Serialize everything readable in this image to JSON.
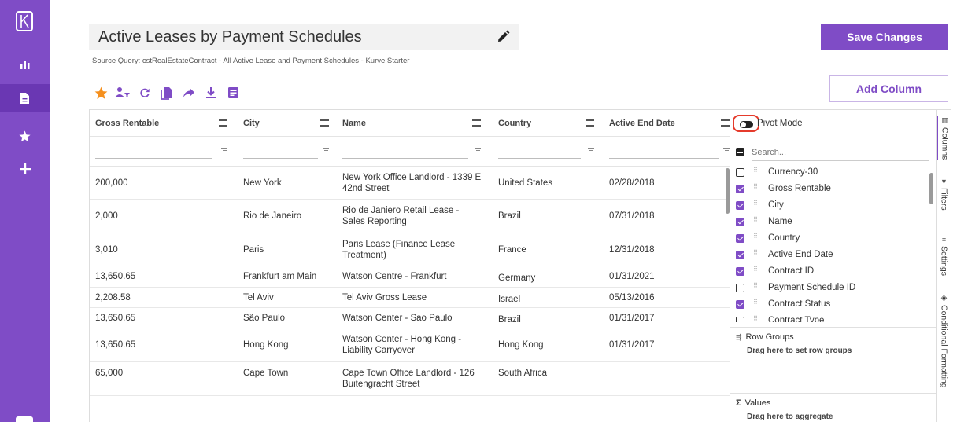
{
  "header": {
    "title": "Active Leases by Payment Schedules",
    "source": "Source Query: cstRealEstateContract - All Active Lease and Payment Schedules - Kurve Starter",
    "save_label": "Save Changes",
    "add_column_label": "Add Column"
  },
  "nav": {
    "items": [
      "chart-icon",
      "report-icon",
      "star-icon",
      "plus-icon"
    ],
    "active": "report-icon"
  },
  "toolbar": {
    "icons": [
      "star-icon",
      "user-filter-icon",
      "refresh-icon",
      "copy-icon",
      "share-icon",
      "download-icon",
      "notes-icon"
    ]
  },
  "grid": {
    "columns": [
      "Gross Rentable",
      "City",
      "Name",
      "Country",
      "Active End Date"
    ],
    "rows": [
      [
        "200,000",
        "New York",
        "New York Office Landlord - 1339 E 42nd Street",
        "United States",
        "02/28/2018"
      ],
      [
        "2,000",
        "Rio de Janeiro",
        "Rio de Janiero Retail Lease - Sales Reporting",
        "Brazil",
        "07/31/2018"
      ],
      [
        "3,010",
        "Paris",
        "Paris Lease (Finance Lease Treatment)",
        "France",
        "12/31/2018"
      ],
      [
        "13,650.65",
        "Frankfurt am Main",
        "Watson Centre - Frankfurt",
        "Germany",
        "01/31/2021"
      ],
      [
        "2,208.58",
        "Tel Aviv",
        "Tel Aviv Gross Lease",
        "Israel",
        "05/13/2016"
      ],
      [
        "13,650.65",
        "São Paulo",
        "Watson Center - Sao Paulo",
        "Brazil",
        "01/31/2017"
      ],
      [
        "13,650.65",
        "Hong Kong",
        "Watson Center - Hong Kong - Liability Carryover",
        "Hong Kong",
        "01/31/2017"
      ],
      [
        "65,000",
        "Cape Town",
        "Cape Town Office Landlord - 126 Buitengracht Street",
        "South Africa",
        ""
      ]
    ]
  },
  "panel": {
    "pivot_mode_label": "Pivot Mode",
    "search_placeholder": "Search...",
    "columns": [
      {
        "label": "Currency-30",
        "checked": false
      },
      {
        "label": "Gross Rentable",
        "checked": true
      },
      {
        "label": "City",
        "checked": true
      },
      {
        "label": "Name",
        "checked": true
      },
      {
        "label": "Country",
        "checked": true
      },
      {
        "label": "Active End Date",
        "checked": true
      },
      {
        "label": "Contract ID",
        "checked": true
      },
      {
        "label": "Payment Schedule ID",
        "checked": false
      },
      {
        "label": "Contract Status",
        "checked": true
      },
      {
        "label": "Contract Type",
        "checked": false
      }
    ],
    "row_groups_title": "Row Groups",
    "row_groups_hint": "Drag here to set row groups",
    "values_title": "Values",
    "values_hint": "Drag here to aggregate"
  },
  "rail": {
    "tabs": [
      "Columns",
      "Filters",
      "Settings",
      "Conditional Formatting"
    ]
  },
  "colors": {
    "accent": "#7f4cc6",
    "nav_active": "#6a37b3",
    "toolbar_orange": "#f5901e",
    "highlight_red": "#e53b2c"
  }
}
